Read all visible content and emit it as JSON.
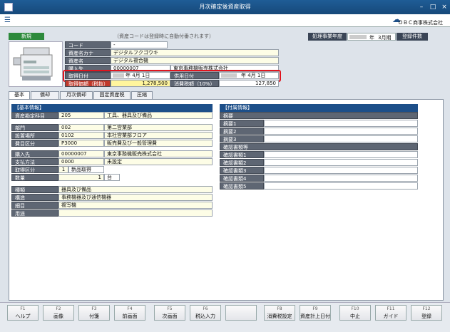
{
  "window": {
    "title": "月次確定後資産取得"
  },
  "header": {
    "company": "ＯＢＣ商事株式会社"
  },
  "top": {
    "new_badge": "新規",
    "note": "（資産コードは登録時に自動付番されます）",
    "fiscal_label": "処理事業年度",
    "year_suffix": "年",
    "month": "3月期",
    "count_label": "登録件数"
  },
  "asset": {
    "code_label": "コード",
    "code_value": "-",
    "kana_label": "資産名カナ",
    "kana_value": "デジタルフクゴウキ",
    "name_label": "資産名",
    "name_value": "デジタル複合機",
    "buyer_label": "購入先",
    "buyer_code": "00000007",
    "buyer_name": "東京事務機販売株式会社",
    "acq_date_label": "取得日付",
    "acq_date_value": "年 4月 1日",
    "use_date_label": "供用日付",
    "use_date_value": "年 4月 1日",
    "acq_price_label": "取得価額（税抜）",
    "acq_price": "1,278,500",
    "tax_label": "消費税額（10%）",
    "tax_value": "127,850"
  },
  "tabs": [
    "基本",
    "償却",
    "月次償却",
    "固定資産税",
    "圧縮"
  ],
  "basic": {
    "section": "【基本情報】",
    "rows": [
      {
        "label": "資産勘定科目",
        "code": "205",
        "name": "工具、器具及び備品"
      },
      {
        "label": "部門",
        "code": "002",
        "name": "第二営業部"
      },
      {
        "label": "設置場所",
        "code": "0102",
        "name": "本社営業部フロア"
      },
      {
        "label": "費目区分",
        "code": "P3000",
        "name": "販売費及び一般管理費"
      },
      {
        "label": "購入先",
        "code": "00000007",
        "name": "東京事務機販売株式会社"
      },
      {
        "label": "支払方法",
        "code": "0000",
        "name": "未設定"
      }
    ],
    "acq_label": "取得区分",
    "acq_num": "1",
    "acq_name": "新品取得",
    "qty_label": "数量",
    "qty_value": "1",
    "qty_unit": "台",
    "kind_rows": [
      {
        "label": "種類",
        "value": "器具及び備品"
      },
      {
        "label": "構造",
        "value": "事務機器及び通信機器"
      },
      {
        "label": "細目",
        "value": "複写機"
      },
      {
        "label": "用途",
        "value": ""
      }
    ]
  },
  "extra": {
    "section": "【付属情報】",
    "memo_head": "摘要",
    "memos": [
      "摘要1",
      "摘要2",
      "摘要3"
    ],
    "doc_head": "確認書類等",
    "docs": [
      "確認書類1",
      "確認書類2",
      "確認書類3",
      "確認書類4",
      "確認書類5"
    ]
  },
  "fkeys": [
    {
      "n": "F1",
      "l": "ヘルプ"
    },
    {
      "n": "F2",
      "l": "画像"
    },
    {
      "n": "F3",
      "l": "付箋"
    },
    {
      "n": "F4",
      "l": "前画面"
    },
    {
      "n": "F5",
      "l": "次画面"
    },
    {
      "n": "F6",
      "l": "税込入力"
    },
    {
      "n": "",
      "l": ""
    },
    {
      "n": "F8",
      "l": "消費税設定"
    },
    {
      "n": "F9",
      "l": "資産計上日付"
    },
    {
      "n": "F10",
      "l": "中止"
    },
    {
      "n": "F11",
      "l": "ガイド"
    },
    {
      "n": "F12",
      "l": "登録"
    }
  ]
}
